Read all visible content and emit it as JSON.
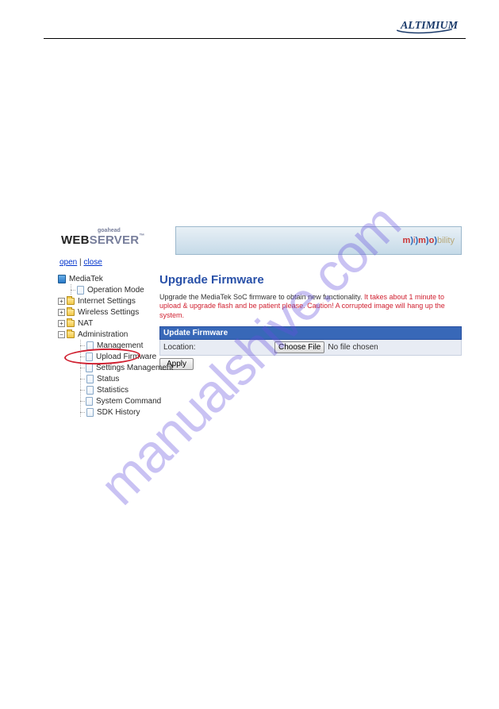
{
  "brand_logo": "ALTIMIUM",
  "watermark": "manualshive.com",
  "header": {
    "goahead": "goahead",
    "web": "WEB",
    "server": "SERVER",
    "tm": "™",
    "mimo_m": "m",
    "mimo_i": "i",
    "mimo_o": "o",
    "mimo_bility": "bility"
  },
  "links": {
    "open": "open",
    "close": "close"
  },
  "tree": {
    "root": "MediaTek",
    "op_mode": "Operation Mode",
    "internet": "Internet Settings",
    "wireless": "Wireless Settings",
    "nat": "NAT",
    "admin": "Administration",
    "admin_items": {
      "management": "Management",
      "upload": "Upload Firmware",
      "settings": "Settings Management",
      "status": "Status",
      "statistics": "Statistics",
      "syscmd": "System Command",
      "sdk": "SDK History"
    }
  },
  "content": {
    "title": "Upgrade Firmware",
    "desc": "Upgrade the MediaTek SoC firmware to obtain new functionality.",
    "warn": " It takes about 1 minute to upload & upgrade flash and be patient please. Caution! A corrupted image will hang up the system.",
    "section_hdr": "Update Firmware",
    "location_lbl": "Location:",
    "choose_btn": "Choose File",
    "no_file": "No file chosen",
    "apply_btn": "Apply"
  }
}
